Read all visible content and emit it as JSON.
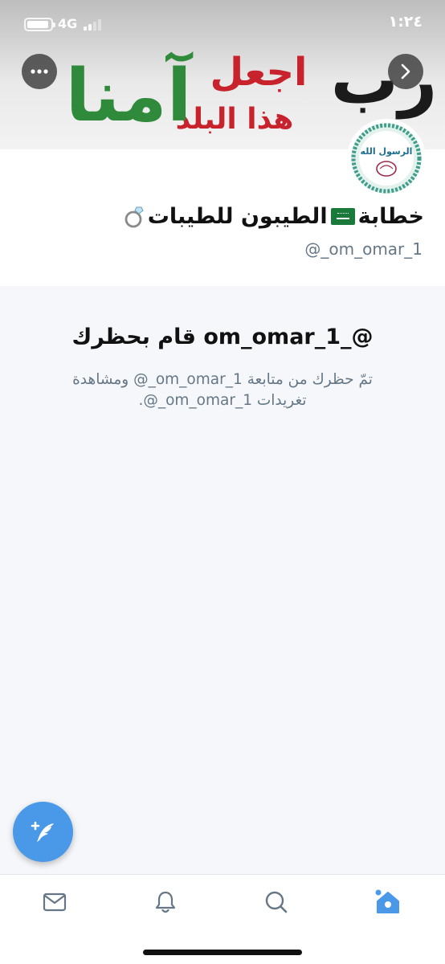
{
  "status_bar": {
    "time": "١:٢٤",
    "network": "4G"
  },
  "banner": {
    "line_1": "رب",
    "line_2": "اجعل",
    "line_3": "هذا البلد",
    "line_4": "آمنا"
  },
  "avatar": {
    "text_top": "الرسول الله"
  },
  "profile": {
    "name_part_1": "خطابة",
    "name_part_2": "الطيبون للطيبات",
    "handle": "@_om_omar_1"
  },
  "blocked_notice": {
    "title": "‏@_om_omar_1 قام بحظرك",
    "body": "تمّ حظرك من متابعة ‎@_om_omar_1‏ ومشاهدة تغريدات ‎@_om_omar_1‏."
  },
  "colors": {
    "accent": "#4a99e9",
    "banner_red": "#c8232c",
    "banner_green": "#2f8a3b",
    "muted_text": "#657786"
  },
  "icons": {
    "more": "ellipsis-icon",
    "forward": "chevron-right-icon",
    "compose": "compose-tweet-icon",
    "messages": "envelope-icon",
    "notifications": "bell-icon",
    "search": "search-icon",
    "home": "home-icon"
  }
}
